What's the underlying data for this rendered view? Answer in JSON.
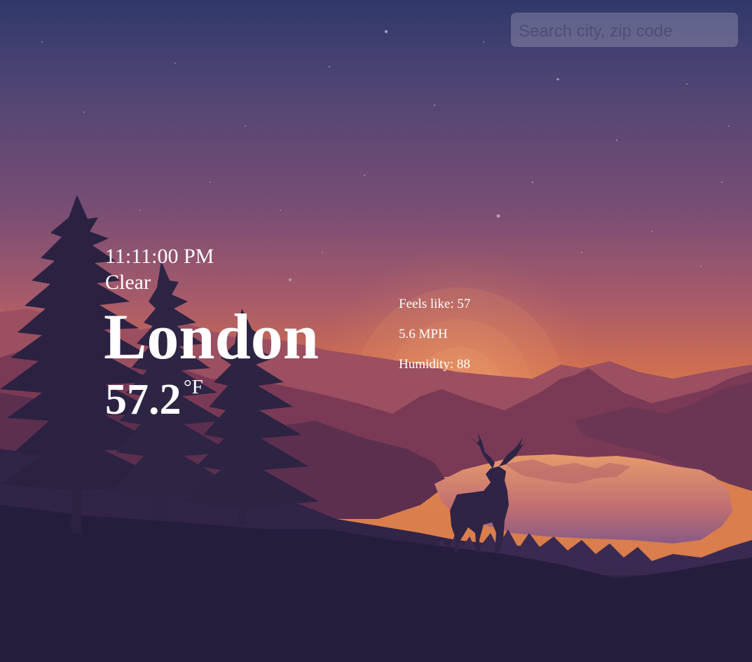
{
  "search": {
    "placeholder": "Search city, zip code",
    "value": ""
  },
  "weather": {
    "time": "11:11:00 PM",
    "condition": "Clear",
    "city": "London",
    "temperature": "57.2",
    "temperature_unit": "°F"
  },
  "details": {
    "feels_like": "Feels like: 57",
    "wind": "5.6 MPH",
    "humidity": "Humidity: 88"
  },
  "background": {
    "scene": "sunset mountain lake landscape with pine trees and deer silhouette",
    "colors": {
      "sky_top": "#33396a",
      "sky_mid": "#8a4f72",
      "horizon": "#d9774a",
      "mountains_far": "#9a4d5e",
      "mountains_mid": "#6e3450",
      "lake": "#e08e6a",
      "foreground": "#261e3d"
    }
  }
}
